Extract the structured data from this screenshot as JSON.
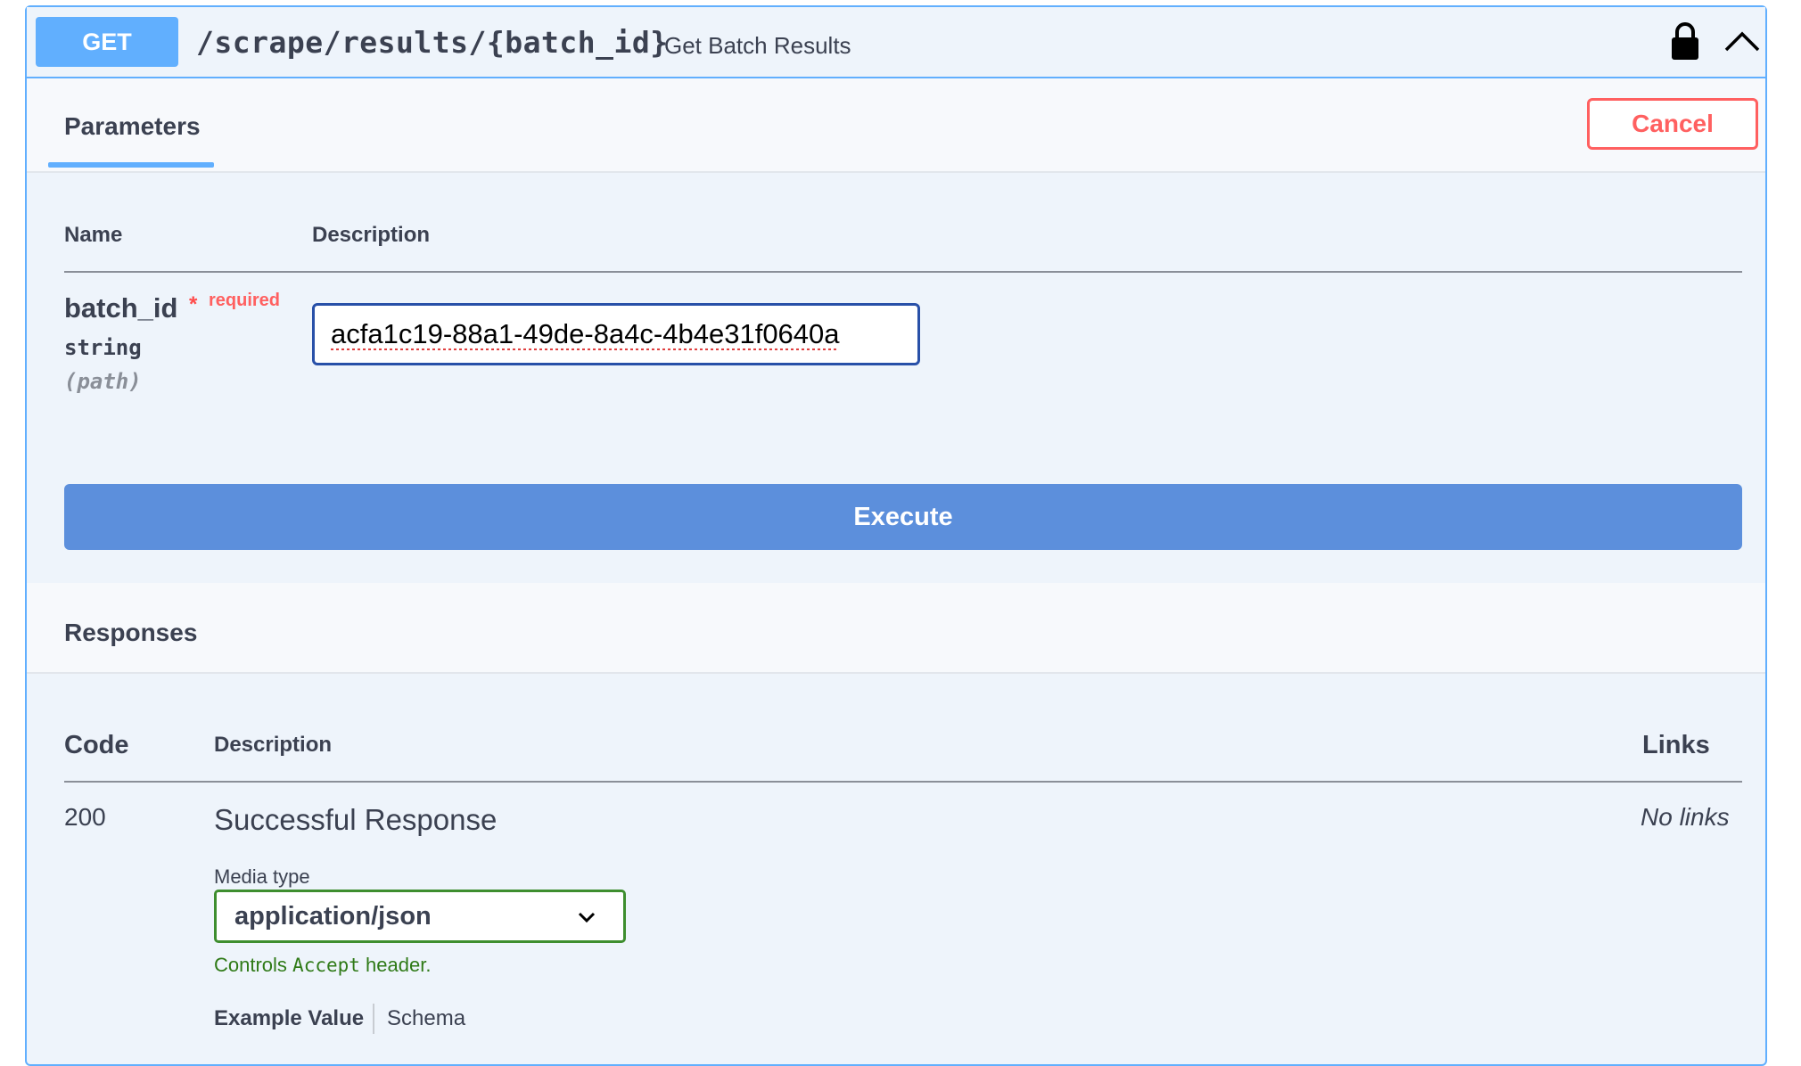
{
  "endpoint": {
    "method": "GET",
    "path": "/scrape/results/{batch_id}",
    "summary": "Get Batch Results"
  },
  "icons": {
    "lock": "lock-icon",
    "collapse": "chevron-up-icon",
    "select": "chevron-down-icon"
  },
  "colors": {
    "get": "#61affe",
    "cancel": "#ff6060",
    "execute": "#5c8fdc",
    "media_border": "#3e8e2f"
  },
  "tabs": {
    "parameters": "Parameters",
    "cancel": "Cancel"
  },
  "params_table": {
    "headers": {
      "name": "Name",
      "description": "Description"
    },
    "rows": [
      {
        "name": "batch_id",
        "required_mark": "*",
        "required_label": "required",
        "type": "string",
        "in": "(path)",
        "value": "acfa1c19-88a1-49de-8a4c-4b4e31f0640a"
      }
    ]
  },
  "execute_label": "Execute",
  "responses": {
    "title": "Responses",
    "headers": {
      "code": "Code",
      "description": "Description",
      "links": "Links"
    },
    "rows": [
      {
        "code": "200",
        "description": "Successful Response",
        "links": "No links",
        "media_type_label": "Media type",
        "media_type": "application/json",
        "controls_prefix": "Controls",
        "controls_code": "Accept",
        "controls_suffix": "header.",
        "example_tab": "Example Value",
        "schema_tab": "Schema"
      }
    ]
  }
}
